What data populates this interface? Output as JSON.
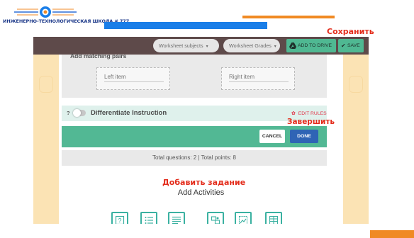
{
  "slide": {
    "school_name": "ИНЖЕНЕРНО-ТЕХНОЛОГИЧЕСКАЯ ШКОЛА # 777",
    "annotations": {
      "save": "Сохранить",
      "finish": "Завершить",
      "add_task": "Добавить задание"
    },
    "colors": {
      "accent_orange": "#f08a24",
      "accent_blue": "#1a7ee8",
      "annotation_red": "#e32c1b"
    }
  },
  "toolbar": {
    "subjects_label": "Worksheet subjects",
    "grades_label": "Worksheet Grades",
    "add_to_drive_label": "ADD TO DRIVE",
    "save_label": "SAVE",
    "caret": "▾",
    "check": "✔"
  },
  "editor": {
    "matching_title": "Add matching pairs",
    "left_placeholder": "Left item",
    "right_placeholder": "Right item",
    "help_mark": "?",
    "differentiate_label": "Differentiate Instruction",
    "edit_rules_label": "EDIT RULES",
    "gear": "✿",
    "cancel_label": "CANCEL",
    "done_label": "DONE",
    "totals_text": "Total questions: 2 | Total points: 8",
    "add_activities_label": "Add Activities"
  },
  "activity_icons": [
    "question-icon",
    "list-icon",
    "text-lines-icon",
    "puzzle-icon",
    "image-select-icon",
    "table-icon"
  ]
}
